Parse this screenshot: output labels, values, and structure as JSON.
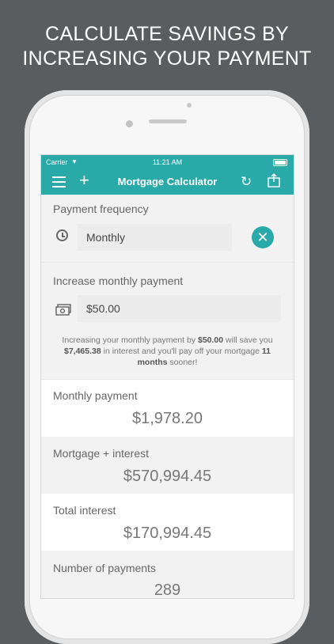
{
  "headline": {
    "line1": "CALCULATE SAVINGS BY",
    "line2": "INCREASING YOUR PAYMENT"
  },
  "status_bar": {
    "carrier": "Carrier",
    "time": "11:21 AM"
  },
  "nav": {
    "title": "Mortgage Calculator",
    "icons": [
      "menu-icon",
      "plus-icon",
      "refresh-icon",
      "share-icon"
    ]
  },
  "payment_frequency": {
    "label": "Payment frequency",
    "value": "Monthly"
  },
  "increase_payment": {
    "label": "Increase monthly payment",
    "value": "$50.00",
    "info": {
      "part1": "Increasing your monthly payment by ",
      "amount": "$50.00",
      "part2": " will save you ",
      "savings": "$7,465.38",
      "part3": " in interest and you'll pay off your mortgage ",
      "months": "11 months",
      "part4": " sooner!"
    }
  },
  "results": {
    "monthly_payment": {
      "label": "Monthly payment",
      "value": "$1,978.20"
    },
    "mortgage_interest": {
      "label": "Mortgage + interest",
      "value": "$570,994.45"
    },
    "total_interest": {
      "label": "Total interest",
      "value": "$170,994.45"
    },
    "number_of_payments": {
      "label": "Number of payments",
      "value": "289"
    }
  },
  "colors": {
    "accent": "#2aa9a9",
    "background": "#5a5d5f"
  }
}
